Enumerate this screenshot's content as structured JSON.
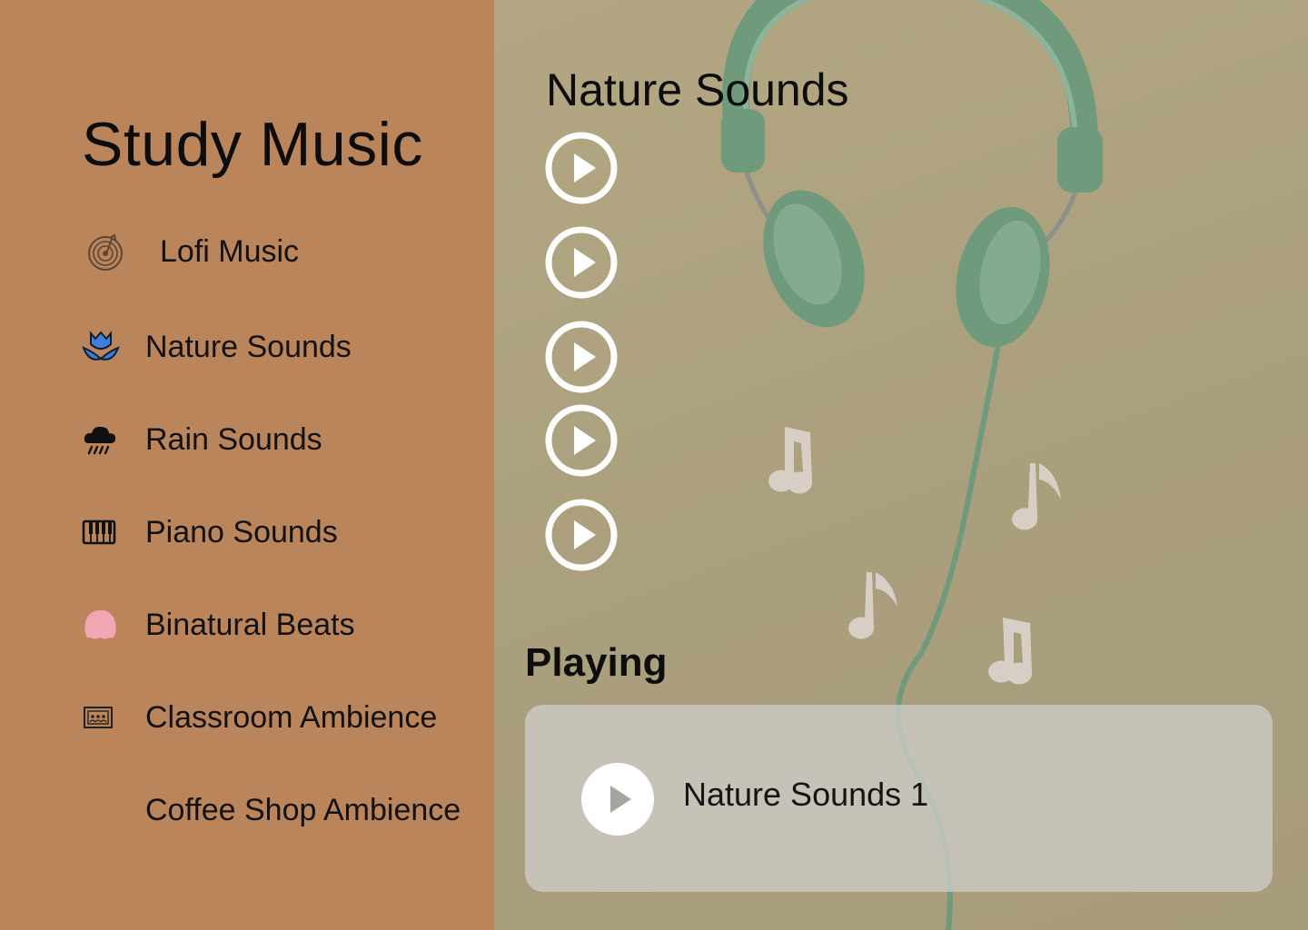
{
  "app": {
    "title": "Study Music"
  },
  "nav": {
    "items": [
      {
        "label": "Lofi Music",
        "icon": "vinyl-record-icon"
      },
      {
        "label": "Nature Sounds",
        "icon": "lotus-icon"
      },
      {
        "label": "Rain Sounds",
        "icon": "rain-cloud-icon"
      },
      {
        "label": "Piano Sounds",
        "icon": "piano-keys-icon"
      },
      {
        "label": "Binatural Beats",
        "icon": "brain-icon"
      },
      {
        "label": "Classroom Ambience",
        "icon": "classroom-board-icon"
      },
      {
        "label": "Coffee Shop Ambience",
        "icon": ""
      }
    ]
  },
  "main": {
    "section_title": "Nature Sounds",
    "tracks_play_icons": [
      "play-icon",
      "play-icon",
      "play-icon",
      "play-icon",
      "play-icon"
    ],
    "playing": {
      "heading": "Playing",
      "track": "Nature Sounds 1",
      "icon": "play-icon"
    }
  },
  "colors": {
    "sidebar": "#bb855b",
    "main_background": "#ada27f",
    "headphones": "#6f9a7c",
    "accent_blue": "#3f7fdc",
    "brain_pink": "#f2a7b5",
    "player_card": "#cecbc7"
  }
}
